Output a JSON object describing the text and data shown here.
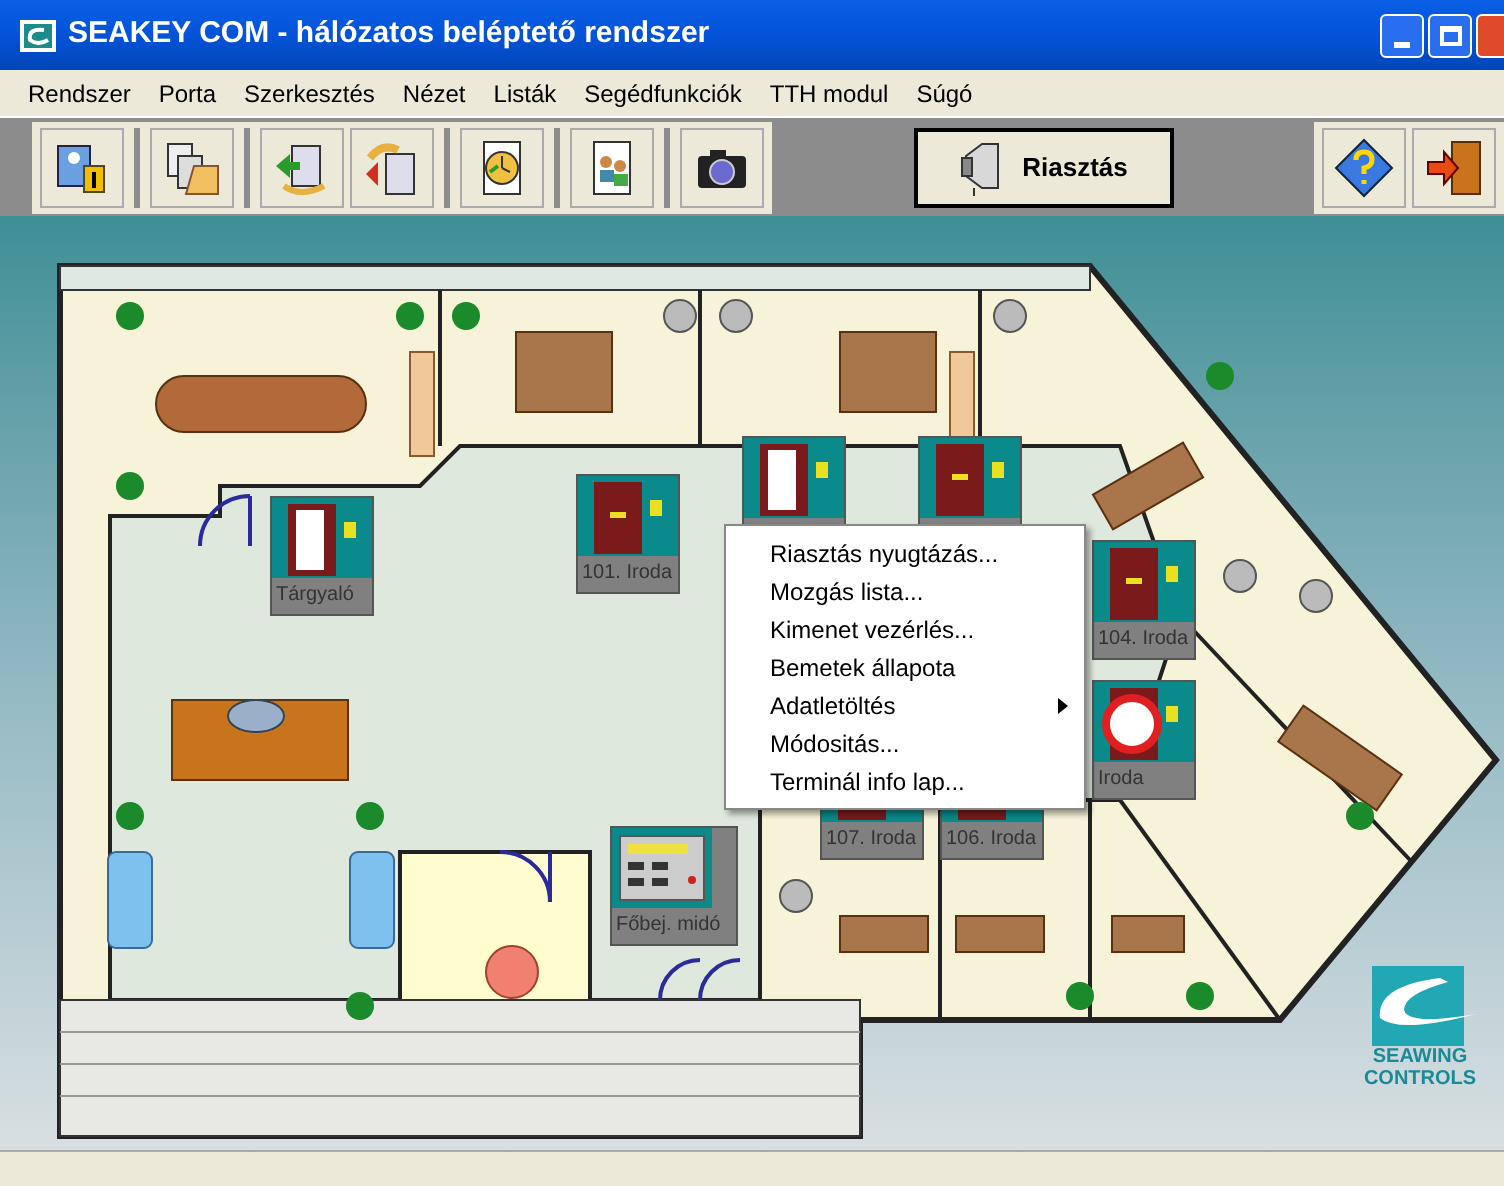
{
  "window": {
    "title": "SEAKEY COM - hálózatos beléptető rendszer"
  },
  "menu_bar": [
    "Rendszer",
    "Porta",
    "Szerkesztés",
    "Nézet",
    "Listák",
    "Segédfunkciók",
    "TTH modul",
    "Súgó"
  ],
  "toolbar": {
    "alarm_button": "Riasztás"
  },
  "terminals": [
    {
      "kind": "door",
      "door_open": true,
      "alarm": false,
      "label": "Tárgyaló"
    },
    {
      "kind": "door",
      "door_open": false,
      "alarm": false,
      "label": "101. Iroda"
    },
    {
      "kind": "door",
      "door_open": true,
      "alarm": false
    },
    {
      "kind": "door",
      "door_open": false,
      "alarm": false
    },
    {
      "kind": "door",
      "door_open": false,
      "alarm": false,
      "label": "104. Iroda"
    },
    {
      "kind": "door",
      "alarm": true,
      "label": "Iroda"
    },
    {
      "kind": "panel",
      "label": "Főbej. midó"
    },
    {
      "kind": "door",
      "door_open": false,
      "alarm": false,
      "label": "107. Iroda"
    },
    {
      "kind": "door",
      "door_open": false,
      "alarm": false,
      "label": "106. Iroda"
    }
  ],
  "context_menu": [
    {
      "label": "Riasztás nyugtázás...",
      "has_submenu": false
    },
    {
      "label": "Mozgás lista...",
      "has_submenu": false
    },
    {
      "label": "Kimenet vezérlés...",
      "has_submenu": false
    },
    {
      "label": "Bemetek állapota",
      "has_submenu": false
    },
    {
      "label": "Adatletöltés",
      "has_submenu": true
    },
    {
      "label": "Módositás...",
      "has_submenu": false
    },
    {
      "label": "Terminál info lap...",
      "has_submenu": false
    }
  ],
  "logo": {
    "line_1": "SEAWING",
    "line_2": "CONTROLS"
  }
}
